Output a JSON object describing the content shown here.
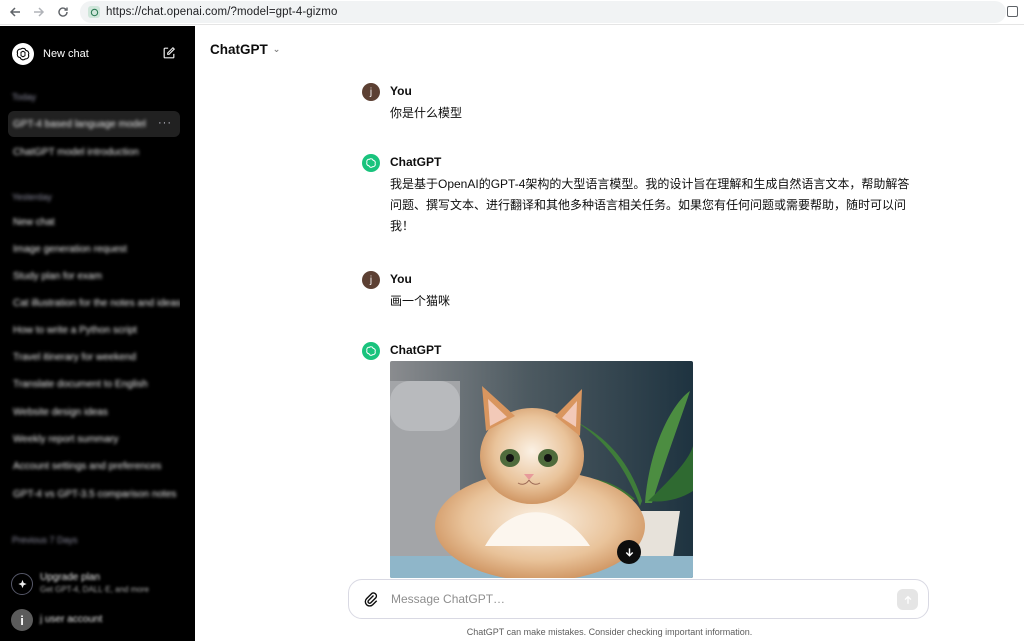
{
  "browser": {
    "url": "https://chat.openai.com/?model=gpt-4-gizmo",
    "back_icon": "arrow-left-icon",
    "forward_icon": "arrow-right-icon",
    "reload_icon": "reload-icon"
  },
  "sidebar": {
    "new_chat_label": "New chat",
    "sections": [
      {
        "label": "Today",
        "items": [
          {
            "label": "GPT-4 based language model"
          },
          {
            "label": "ChatGPT model introduction"
          }
        ]
      },
      {
        "label": "Yesterday",
        "items": [
          {
            "label": "New chat"
          },
          {
            "label": "Image generation request"
          },
          {
            "label": "Study plan for exam"
          },
          {
            "label": "Cat illustration for the notes and ideas"
          },
          {
            "label": "How to write a Python script"
          },
          {
            "label": "Travel itinerary for weekend"
          },
          {
            "label": "Translate document to English"
          },
          {
            "label": "Website design ideas"
          },
          {
            "label": "Weekly report summary"
          },
          {
            "label": "Account settings and preferences"
          },
          {
            "label": "GPT-4 vs GPT-3.5 comparison notes"
          }
        ]
      }
    ],
    "section3_label": "Previous 7 Days",
    "upgrade": {
      "title": "Upgrade plan",
      "subtitle": "Get GPT-4, DALL·E, and more"
    },
    "user": {
      "initial": "i",
      "name": "j user account"
    }
  },
  "header": {
    "model_label": "ChatGPT"
  },
  "messages": [
    {
      "author": "You",
      "avatar": "j",
      "text": "你是什么模型"
    },
    {
      "author": "ChatGPT",
      "text": "我是基于OpenAI的GPT-4架构的大型语言模型。我的设计旨在理解和生成自然语言文本，帮助解答问题、撰写文本、进行翻译和其他多种语言相关任务。如果您有任何问题或需要帮助，随时可以问我！"
    },
    {
      "author": "You",
      "avatar": "j",
      "text": "画一个猫咪"
    },
    {
      "author": "ChatGPT",
      "text": ""
    }
  ],
  "composer": {
    "placeholder": "Message ChatGPT…"
  },
  "disclaimer": "ChatGPT can make mistakes. Consider checking important information.",
  "colors": {
    "sidebar_bg": "#000000",
    "gpt_avatar": "#19c37d",
    "user_avatar": "#5c4033"
  }
}
